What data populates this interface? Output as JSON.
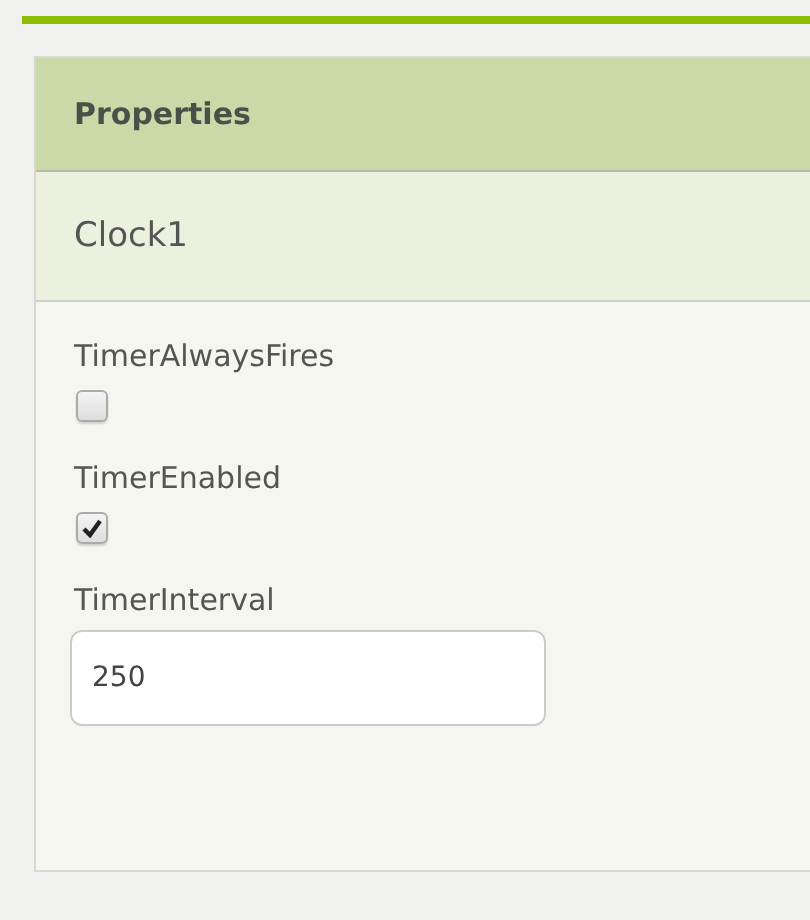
{
  "panel": {
    "title": "Properties",
    "component": "Clock1"
  },
  "properties": [
    {
      "kind": "checkbox",
      "label": "TimerAlwaysFires",
      "checked": false
    },
    {
      "kind": "checkbox",
      "label": "TimerEnabled",
      "checked": true
    },
    {
      "kind": "text",
      "label": "TimerInterval",
      "value": "250"
    }
  ]
}
